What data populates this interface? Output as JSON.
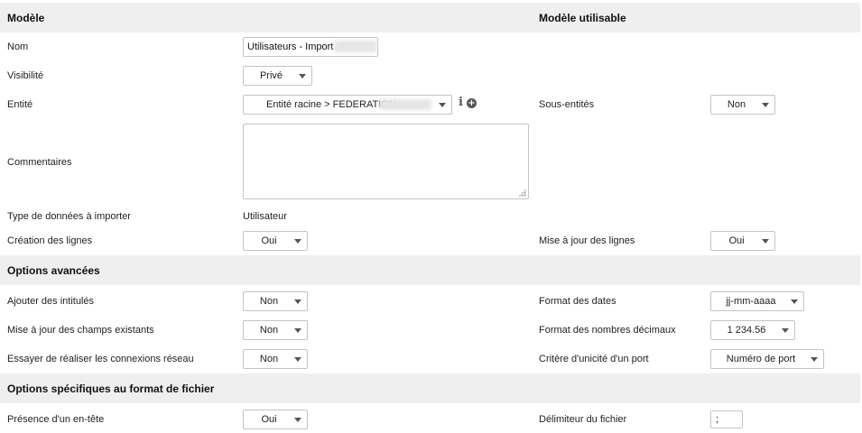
{
  "sections": {
    "model": {
      "title": "Modèle",
      "usable_title": "Modèle utilisable"
    },
    "advanced": {
      "title": "Options avancées"
    },
    "file_format": {
      "title": "Options spécifiques au format de fichier"
    }
  },
  "fields": {
    "name": {
      "label": "Nom",
      "value": "Utilisateurs - Import"
    },
    "visibility": {
      "label": "Visibilité",
      "value": "Privé"
    },
    "entity": {
      "label": "Entité",
      "value": "Entité racine > FEDERATION"
    },
    "sub_entities": {
      "label": "Sous-entités",
      "value": "Non"
    },
    "comments": {
      "label": "Commentaires",
      "value": ""
    },
    "data_type": {
      "label": "Type de données à importer",
      "value": "Utilisateur"
    },
    "line_creation": {
      "label": "Création des lignes",
      "value": "Oui"
    },
    "line_update": {
      "label": "Mise à jour des lignes",
      "value": "Oui"
    },
    "add_headers": {
      "label": "Ajouter des intitulés",
      "value": "Non"
    },
    "date_format": {
      "label": "Format des dates",
      "value": "jj-mm-aaaa"
    },
    "update_existing": {
      "label": "Mise à jour des champs existants",
      "value": "Non"
    },
    "decimal_format": {
      "label": "Format des nombres décimaux",
      "value": "1 234.56"
    },
    "network_connections": {
      "label": "Essayer de réaliser les connexions réseau",
      "value": "Non"
    },
    "port_uniqueness": {
      "label": "Critère d'unicité d'un port",
      "value": "Numéro de port"
    },
    "header_present": {
      "label": "Présence d'un en-tête",
      "value": "Oui"
    },
    "file_delimiter": {
      "label": "Délimiteur du fichier",
      "value": ";"
    }
  },
  "icons": {
    "info": "info-icon",
    "add": "add-circle-icon"
  }
}
